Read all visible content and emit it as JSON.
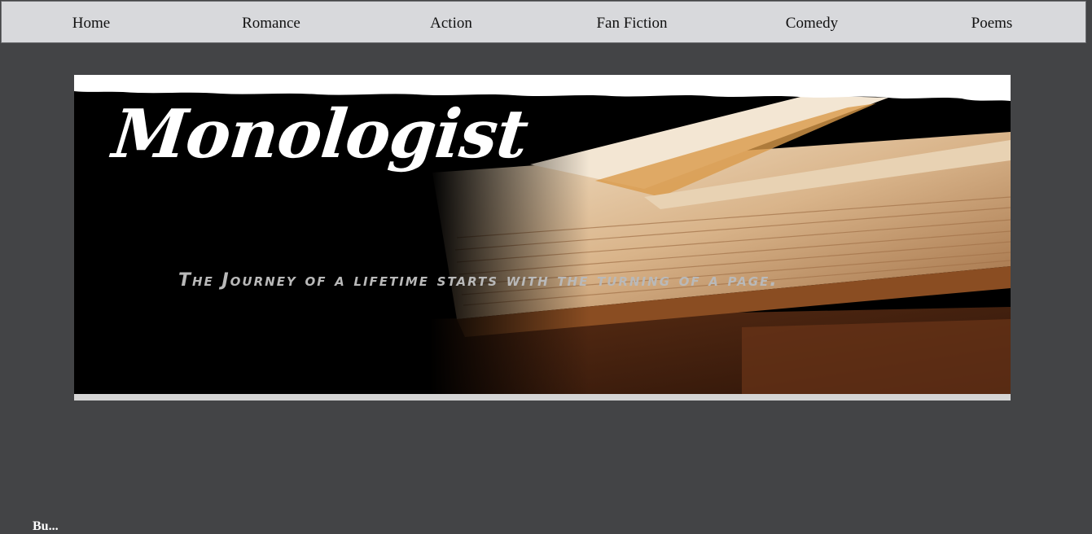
{
  "nav": {
    "items": [
      {
        "label": "Home"
      },
      {
        "label": "Romance"
      },
      {
        "label": "Action"
      },
      {
        "label": "Fan Fiction"
      },
      {
        "label": "Comedy"
      },
      {
        "label": "Poems"
      }
    ]
  },
  "banner": {
    "title": "Monologist",
    "tagline": "The Journey of a lifetime starts with the turning of a page."
  },
  "footer": {
    "partial_text": "Bu..."
  },
  "colors": {
    "page_background": "#434446",
    "nav_background": "#d8d9dc",
    "banner_background": "#000000",
    "title_color": "#ffffff",
    "tagline_color": "#b9b9b9"
  }
}
